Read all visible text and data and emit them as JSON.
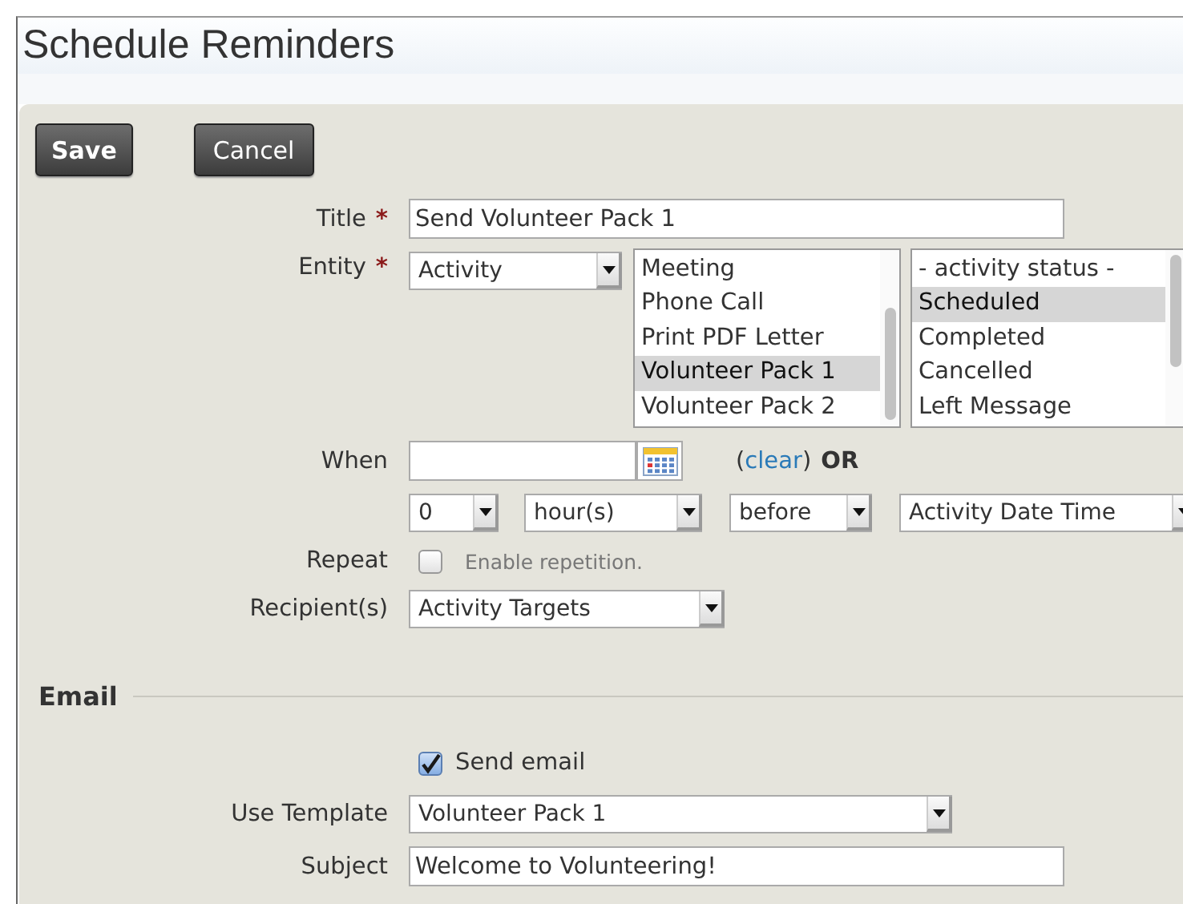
{
  "page_title": "Schedule Reminders",
  "buttons": [
    {
      "label": "Save"
    },
    {
      "label": "Cancel"
    }
  ],
  "title_field": {
    "label": "Title",
    "required_mark": "*",
    "value": "Send Volunteer Pack 1"
  },
  "entity": {
    "label": "Entity",
    "required_mark": "*",
    "value": "Activity",
    "types": [
      {
        "label": "Meeting",
        "selected": false
      },
      {
        "label": "Phone Call",
        "selected": false
      },
      {
        "label": "Print PDF Letter",
        "selected": false
      },
      {
        "label": "Volunteer Pack 1",
        "selected": true
      },
      {
        "label": "Volunteer Pack 2",
        "selected": false
      }
    ],
    "statuses": [
      {
        "label": "- activity status -",
        "selected": false
      },
      {
        "label": "Scheduled",
        "selected": true
      },
      {
        "label": "Completed",
        "selected": false
      },
      {
        "label": "Cancelled",
        "selected": false
      },
      {
        "label": "Left Message",
        "selected": false
      }
    ]
  },
  "when": {
    "label": "When",
    "clear_prefix": "(",
    "clear_link": "clear",
    "clear_suffix": ")",
    "or_text": "OR"
  },
  "offset": {
    "amount": "0",
    "unit": "hour(s)",
    "direction": "before",
    "field": "Activity Date Time"
  },
  "repeat": {
    "label": "Repeat",
    "checked": false,
    "text": "Enable repetition."
  },
  "recipients": {
    "label": "Recipient(s)",
    "value": "Activity Targets"
  },
  "email": {
    "heading": "Email",
    "send_email": {
      "label": "Send email",
      "checked": true
    },
    "template": {
      "label": "Use Template",
      "value": "Volunteer Pack 1"
    },
    "subject": {
      "label": "Subject",
      "value": "Welcome to Volunteering!"
    }
  }
}
